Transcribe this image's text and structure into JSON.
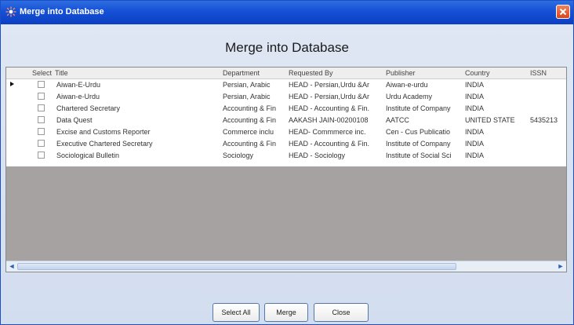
{
  "window": {
    "title": "Merge into Database",
    "close_glyph": "✕"
  },
  "dialog": {
    "heading": "Merge into Database"
  },
  "grid": {
    "columns": [
      "Select",
      "Title",
      "Department",
      "Requested By",
      "Publisher",
      "Country",
      "ISSN"
    ],
    "rows": [
      {
        "title": "Aiwan-E-Urdu",
        "department": "Persian, Arabic",
        "requested_by": "HEAD - Persian,Urdu &Ar",
        "publisher": "Aiwan-e-urdu",
        "country": "INDIA",
        "issn": ""
      },
      {
        "title": "Aiwan-e-Urdu",
        "department": "Persian, Arabic",
        "requested_by": "HEAD - Persian,Urdu &Ar",
        "publisher": "Urdu Academy",
        "country": "INDIA",
        "issn": ""
      },
      {
        "title": "Chartered Secretary",
        "department": "Accounting & Fin",
        "requested_by": "HEAD - Accounting & Fin.",
        "publisher": "Institute of Company",
        "country": "INDIA",
        "issn": ""
      },
      {
        "title": "Data Quest",
        "department": "Accounting & Fin",
        "requested_by": "AAKASH JAIN-00200108",
        "publisher": "AATCC",
        "country": "UNITED STATE",
        "issn": "5435213"
      },
      {
        "title": "Excise and Customs Reporter",
        "department": "Commerce inclu",
        "requested_by": "HEAD- Commmerce inc.",
        "publisher": "Cen - Cus Publicatio",
        "country": "INDIA",
        "issn": ""
      },
      {
        "title": "Executive Chartered Secretary",
        "department": "Accounting & Fin",
        "requested_by": "HEAD - Accounting & Fin.",
        "publisher": "Institute of Company",
        "country": "INDIA",
        "issn": ""
      },
      {
        "title": "Sociological Bulletin",
        "department": "Sociology",
        "requested_by": "HEAD - Sociology",
        "publisher": "Institute of Social Sci",
        "country": "INDIA",
        "issn": ""
      }
    ]
  },
  "scrollbar": {
    "left_glyph": "◄",
    "right_glyph": "►"
  },
  "buttons": {
    "select_all": "Select All",
    "merge": "Merge",
    "close": "Close"
  }
}
